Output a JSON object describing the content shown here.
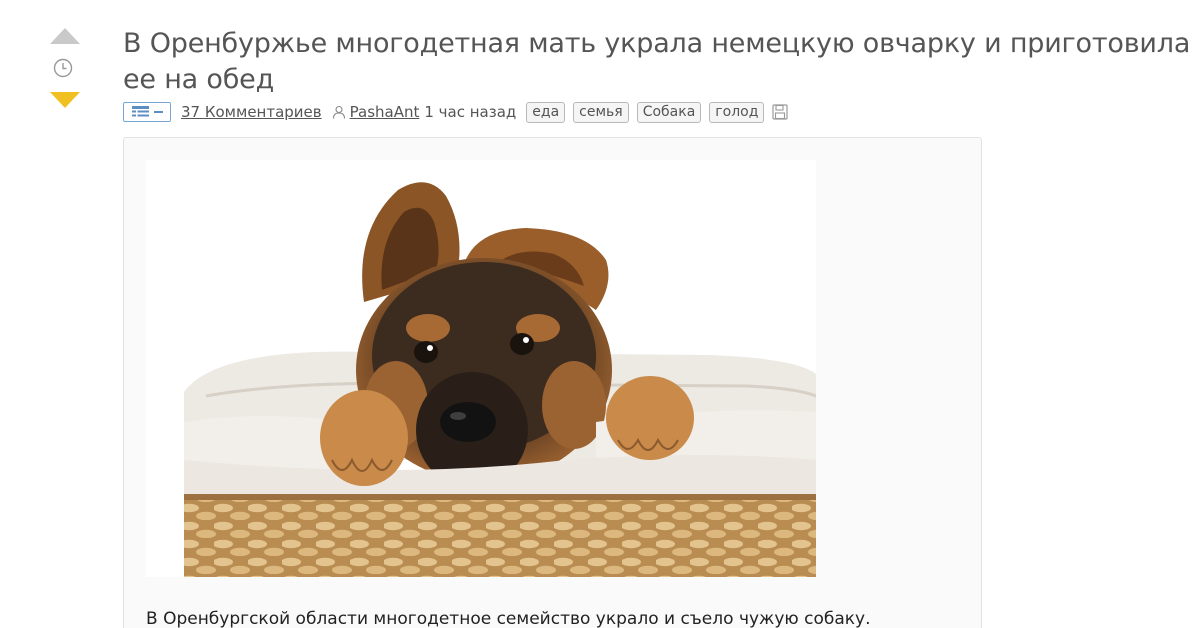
{
  "post": {
    "title": "В Оренбуржье многодетная мать украла немецкую овчарку и приготовила ее на обед",
    "comments": "37 Комментариев",
    "author": "PashaAnt",
    "time": "1 час назад",
    "tags": [
      "еда",
      "семья",
      "Собака",
      "голод"
    ],
    "body": "В Оренбургской области многодетное семейство украло и съело чужую собаку."
  },
  "icons": {
    "vote_up": "triangle-up",
    "clock": "clock-icon",
    "vote_down": "triangle-down",
    "toggle": "list-view-icon",
    "user": "user-icon",
    "save": "floppy-disk-icon"
  },
  "colors": {
    "vote_up": "#c9c9c9",
    "vote_down": "#f0c020",
    "toggle_border": "#7aa8d4",
    "title": "#555555"
  }
}
